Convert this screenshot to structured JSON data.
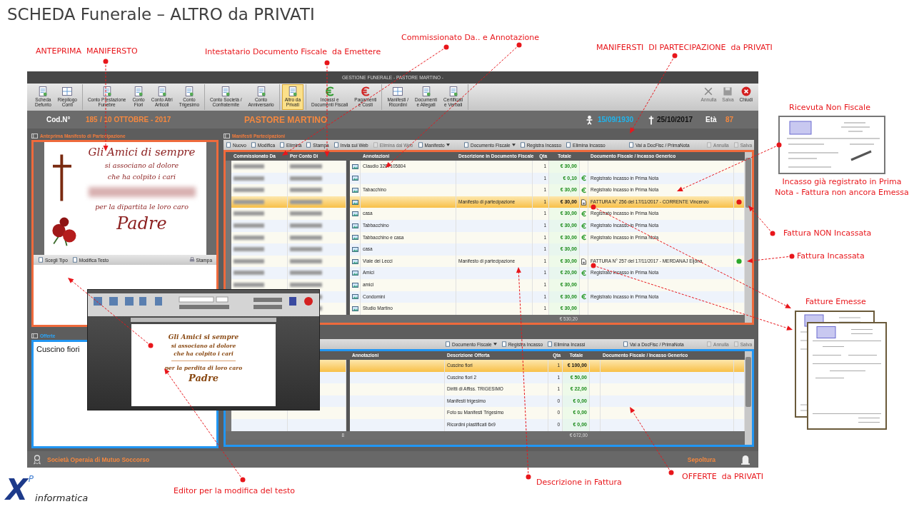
{
  "title": "SCHEDA Funerale – ALTRO da PRIVATI",
  "annotations": [
    {
      "text": "ANTEPRIMA  MANIFERSTO"
    },
    {
      "text": "Intestatario Documento Fiscale  da Emettere"
    },
    {
      "text": "Commissionato Da.. e Annotazione"
    },
    {
      "text": "MANIFERSTI  DI PARTECIPAZIONE  da PRIVATI"
    },
    {
      "text": "Ricevuta Non Fiscale"
    },
    {
      "text": "Incasso già registrato in Prima Nota - Fattura non ancora Emessa"
    },
    {
      "text": "Fattura NON Incassata"
    },
    {
      "text": "Fattura Incassata"
    },
    {
      "text": "Fatture Emesse"
    },
    {
      "text": "Editor per la modifica del testo"
    },
    {
      "text": "Descrizione in Fattura"
    },
    {
      "text": "OFFERTE  da PRIVATI"
    }
  ],
  "window": {
    "title": "GESTIONE FUNERALE - PASTORE MARTINO -",
    "ribbon": [
      [
        {
          "label": "Scheda\nDefunto",
          "kind": "doc",
          "selected": false
        },
        {
          "label": "Riepilogo\nConti",
          "kind": "grid",
          "selected": false
        }
      ],
      [
        {
          "label": "Conto Prestazione\nFunebre",
          "kind": "doc",
          "selected": false
        },
        {
          "label": "Conto\nFiori",
          "kind": "doc",
          "selected": false
        },
        {
          "label": "Conto Altri\nArticoli",
          "kind": "doc",
          "selected": false
        },
        {
          "label": "Conto\nTrigesimo",
          "kind": "doc",
          "selected": false
        }
      ],
      [
        {
          "label": "Conto Società /\nConfraternite",
          "kind": "doc",
          "selected": false
        },
        {
          "label": "Conto\nAnniversario",
          "kind": "doc",
          "selected": false
        }
      ],
      [
        {
          "label": "Altro da\nPrivati",
          "kind": "doc",
          "selected": true
        }
      ],
      [
        {
          "label": "Incassi e\nDocumenti Fiscali",
          "kind": "euro-in",
          "selected": false
        },
        {
          "label": "Pagamenti\ne Costi",
          "kind": "euro-out",
          "selected": false
        }
      ],
      [
        {
          "label": "Manifesti /\nRicordini",
          "kind": "grid",
          "selected": false
        },
        {
          "label": "Documenti\ne Allegati",
          "kind": "doc",
          "selected": false
        },
        {
          "label": "Certificati\ne Verbali",
          "kind": "doc",
          "selected": false
        }
      ]
    ],
    "ribbon_right": [
      {
        "label": "Annulla",
        "kind": "cancel",
        "disabled": true
      },
      {
        "label": "Salva",
        "kind": "save",
        "disabled": true
      },
      {
        "label": "Chiudi",
        "kind": "close",
        "disabled": false
      }
    ],
    "header": {
      "code_label": "Cod.N°",
      "code": "185",
      "date": "/ 10 OTTOBRE - 2017",
      "name": "PASTORE MARTINO",
      "birth": "15/09/1930",
      "death": "25/10/2017",
      "age_label": "Età",
      "age": "87"
    },
    "preview_panel": {
      "title": "Anteprima Manifesto di Partecipazione",
      "lines": [
        "Gli Amici di sempre",
        "si associano al dolore",
        "che ha colpito i cari",
        "per la dipartita le loro caro",
        "Padre"
      ],
      "tools": [
        {
          "label": "Scegli Tipo"
        },
        {
          "label": "Modifica Testo"
        }
      ],
      "print": "Stampa"
    },
    "offers_panel": {
      "title": "Offerte",
      "text": "Cuscino fiori"
    },
    "manifests": {
      "title": "Manifesti Partecipazioni",
      "toolbar": [
        [
          {
            "label": "Nuovo",
            "disabled": false,
            "menu": false
          },
          {
            "label": "Modifica",
            "disabled": false,
            "menu": false
          },
          {
            "label": "Elimina",
            "disabled": false,
            "menu": false
          },
          {
            "label": "Stampa",
            "disabled": false,
            "menu": false
          },
          {
            "label": "Invia sul Web",
            "disabled": false,
            "menu": false
          },
          {
            "label": "Elimina dal Web",
            "disabled": true,
            "menu": false
          },
          {
            "label": "Manifesto",
            "disabled": false,
            "menu": true
          }
        ],
        [
          {
            "label": "Documento Fiscale",
            "disabled": false,
            "menu": true
          },
          {
            "label": "Registra Incasso",
            "disabled": false,
            "menu": false
          },
          {
            "label": "Elimina Incasso",
            "disabled": false,
            "menu": false
          }
        ],
        [
          {
            "label": "Vai a DocFisc / PrimaNota",
            "disabled": false,
            "menu": false
          }
        ],
        [
          {
            "label": "Annulla",
            "disabled": true,
            "menu": false
          },
          {
            "label": "Salva",
            "disabled": true,
            "menu": false
          }
        ]
      ],
      "columns": [
        "Commissionato Da",
        "Per Conto Di",
        "Annotazioni",
        "Descrizione in Documento Fiscale",
        "Qta",
        "Totale",
        "Documento Fiscale / Incasso Generico"
      ],
      "rows": [
        {
          "annotation": "Claudio 3287105804",
          "description": "",
          "qty": "1",
          "total": "€ 30,00",
          "kind": "none",
          "document": "",
          "selected": false
        },
        {
          "annotation": "",
          "description": "",
          "qty": "1",
          "total": "€ 0,10",
          "kind": "euro",
          "document": "Registrato Incasso in Prima Nota",
          "selected": false
        },
        {
          "annotation": "Tabacchino",
          "description": "",
          "qty": "1",
          "total": "€ 30,00",
          "kind": "euro",
          "document": "Registrato Incasso in Prima Nota",
          "selected": false
        },
        {
          "annotation": "",
          "description": "Manifesto di partecipazione",
          "qty": "1",
          "total": "€ 30,00",
          "kind": "invoice",
          "document": "FATTURA N° 256 del 17/11/2017 - CORRENTE Vincenzo",
          "selected": true,
          "color": "#e01818"
        },
        {
          "annotation": "casa",
          "description": "",
          "qty": "1",
          "total": "€ 30,00",
          "kind": "euro",
          "document": "Registrato Incasso in Prima Nota",
          "selected": false
        },
        {
          "annotation": "Tabbacchino",
          "description": "",
          "qty": "1",
          "total": "€ 30,00",
          "kind": "euro",
          "document": "Registrato Incasso in Prima Nota",
          "selected": false
        },
        {
          "annotation": "Tabbacchino e casa",
          "description": "",
          "qty": "1",
          "total": "€ 30,00",
          "kind": "euro",
          "document": "Registrato Incasso in Prima Nota",
          "selected": false
        },
        {
          "annotation": "casa",
          "description": "",
          "qty": "1",
          "total": "€ 30,00",
          "kind": "none",
          "document": "",
          "selected": false
        },
        {
          "annotation": "Viale dei Lecci",
          "description": "Manifesto di partecipazione",
          "qty": "1",
          "total": "€ 30,00",
          "kind": "invoice",
          "document": "FATTURA N° 257 del 17/11/2017 - MERDANAJ Eljona",
          "selected": false,
          "color": "#2aa82a"
        },
        {
          "annotation": "Amici",
          "description": "",
          "qty": "1",
          "total": "€ 20,00",
          "kind": "euro",
          "document": "Registrato Incasso in Prima Nota",
          "selected": false
        },
        {
          "annotation": "amici",
          "description": "",
          "qty": "1",
          "total": "€ 30,00",
          "kind": "none",
          "document": "",
          "selected": false
        },
        {
          "annotation": "Condomini",
          "description": "",
          "qty": "1",
          "total": "€ 30,00",
          "kind": "euro",
          "document": "Registrato Incasso in Prima Nota",
          "selected": false
        },
        {
          "annotation": "Studio Martino",
          "description": "",
          "qty": "1",
          "total": "€ 30,00",
          "kind": "none",
          "document": "",
          "selected": false
        }
      ],
      "total": "€ 530,20"
    },
    "offers": {
      "toolbar": [
        [
          {
            "label": "Documento Fiscale",
            "disabled": false,
            "menu": true
          },
          {
            "label": "Registra Incasso",
            "disabled": false,
            "menu": false
          },
          {
            "label": "Elimina Incassi",
            "disabled": false,
            "menu": false
          }
        ],
        [
          {
            "label": "Vai a DocFisc / PrimaNota",
            "disabled": false,
            "menu": false
          }
        ],
        [
          {
            "label": "Annulla",
            "disabled": true,
            "menu": false
          },
          {
            "label": "Salva",
            "disabled": true,
            "menu": false
          }
        ]
      ],
      "columns": [
        "Annotazioni",
        "Descrizione Offerta",
        "Qta",
        "Totale",
        "Documento Fiscale / Incasso Generico"
      ],
      "rows": [
        {
          "description": "Cuscino fiori",
          "qty": "1",
          "total": "€ 100,00",
          "selected": true
        },
        {
          "description": "Cuscino fiori 2",
          "qty": "1",
          "total": "€ 50,00",
          "selected": false
        },
        {
          "description": "Diritti di Affiss. TRIGESIMO",
          "qty": "1",
          "total": "€ 22,00",
          "selected": false
        },
        {
          "description": "Manifesti trigesimo",
          "qty": "0",
          "total": "€ 0,00",
          "selected": false
        },
        {
          "description": "Foto su Manifesti Trigesimo",
          "qty": "0",
          "total": "€ 0,00",
          "selected": false
        },
        {
          "description": "Ricordini plastificati 6x9",
          "qty": "0",
          "total": "€ 0,00",
          "selected": false
        }
      ],
      "count": "8",
      "total": "€ 672,00"
    },
    "status_bar": {
      "left": "Società Operaia di Mutuo Soccorso",
      "right": "Sepoltura"
    }
  },
  "editor": {
    "lines": [
      "Gli Amici si sempre",
      "si associano al dolore",
      "che ha colpito i cari",
      "per la perdita di loro caro",
      "Padre"
    ]
  },
  "logo": {
    "mark": "X",
    "sup": "P",
    "word": "informatica"
  }
}
